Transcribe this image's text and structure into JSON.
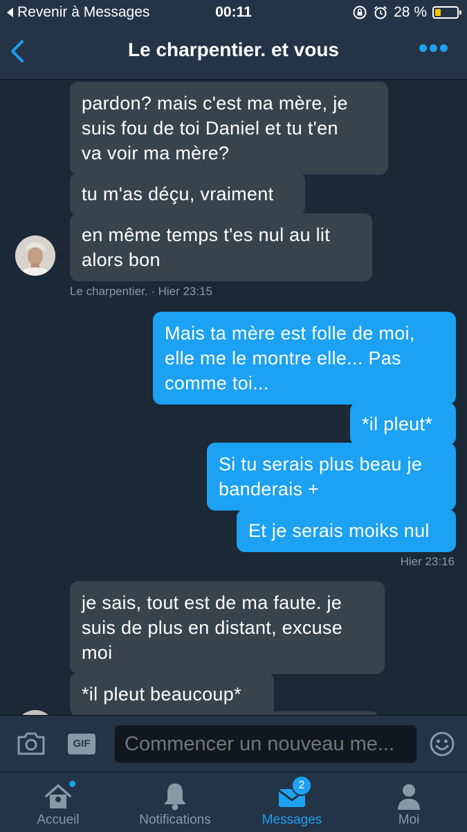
{
  "status_bar": {
    "back_label": "Revenir à Messages",
    "time": "00:11",
    "battery_text": "28 %",
    "battery_level": 0.28
  },
  "header": {
    "title": "Le charpentier. et vous",
    "back_icon": "chevron-left-icon",
    "more_icon": "more-dots-icon"
  },
  "messages": [
    {
      "side": "in",
      "lines": [
        "pardon? mais c'est ma mère, je",
        "suis fou de toi Daniel et tu t'en",
        "va voir ma mère?"
      ]
    },
    {
      "side": "in",
      "lines": [
        "tu m'as déçu, vraiment"
      ]
    },
    {
      "side": "in",
      "lines": [
        "en même temps t'es nul au lit",
        "alors bon"
      ]
    },
    {
      "side": "out",
      "lines": [
        "Mais ta mère est folle de moi,",
        "elle me le montre elle... Pas",
        "comme toi..."
      ]
    },
    {
      "side": "out",
      "lines": [
        "*il pleut*"
      ]
    },
    {
      "side": "out",
      "lines": [
        "Si tu serais plus beau je",
        "banderais +"
      ]
    },
    {
      "side": "out",
      "lines": [
        "Et je serais moiks nul"
      ]
    },
    {
      "side": "in",
      "lines": [
        "je sais, tout est de ma faute. je",
        "suis de plus en distant, excuse",
        "moi"
      ]
    },
    {
      "side": "in",
      "lines": [
        "*il pleut beaucoup*"
      ]
    }
  ],
  "meta": {
    "incoming_1": "Le charpentier. · Hier 23:15",
    "outgoing_1": "Hier 23:16"
  },
  "composer": {
    "placeholder": "Commencer un nouveau me...",
    "camera_icon": "camera-icon",
    "gif_label": "GIF",
    "emoji_icon": "emoji-icon"
  },
  "tabs": [
    {
      "label": "Accueil",
      "icon": "home-icon",
      "active": false
    },
    {
      "label": "Notifications",
      "icon": "bell-icon",
      "active": false
    },
    {
      "label": "Messages",
      "icon": "envelope-icon",
      "active": true,
      "badge": "2"
    },
    {
      "label": "Moi",
      "icon": "person-icon",
      "active": false
    }
  ],
  "colors": {
    "background": "#1b2836",
    "bar": "#243447",
    "incoming": "#38444d",
    "outgoing": "#1da1f2",
    "muted": "#8899a6"
  }
}
